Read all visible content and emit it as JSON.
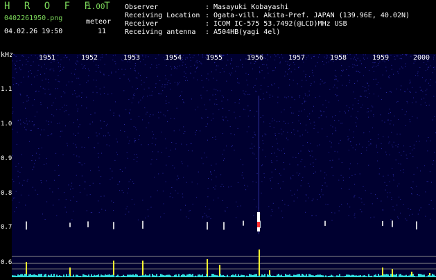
{
  "header": {
    "logo": "H R O F F T",
    "version": "1.00",
    "filename": "0402261950.png",
    "meteor_label": "meteor",
    "datetime": "04.02.26 19:50",
    "meteor_count": "11"
  },
  "info": [
    {
      "label": "Observer",
      "value": ": Masayuki Kobayashi"
    },
    {
      "label": "Receiving Location",
      "value": ": Ogata-vill. Akita-Pref. JAPAN (139.96E, 40.02N)"
    },
    {
      "label": "Receiver",
      "value": ": ICOM IC-575 53.7492(@LCD)MHz USB"
    },
    {
      "label": "Receiving antenna",
      "value": ": A504HB(yagi 4el)"
    }
  ],
  "axis": {
    "y_unit": "kHz",
    "y_ticks": [
      "1.1",
      "1.0",
      "0.9",
      "0.8",
      "0.7",
      "0.6"
    ],
    "x_ticks": [
      "1951",
      "1952",
      "1953",
      "1954",
      "1955",
      "1956",
      "1957",
      "1958",
      "1959",
      "2000"
    ]
  },
  "colors": {
    "background": "#000000",
    "spectrogram": "#000030",
    "noise": "#2a2aa8",
    "logo": "#7cd85a",
    "echo": "#ffffff",
    "echo_core": "#ff3030",
    "burst": "#ffff30",
    "baseline": "#30e0e0"
  }
}
